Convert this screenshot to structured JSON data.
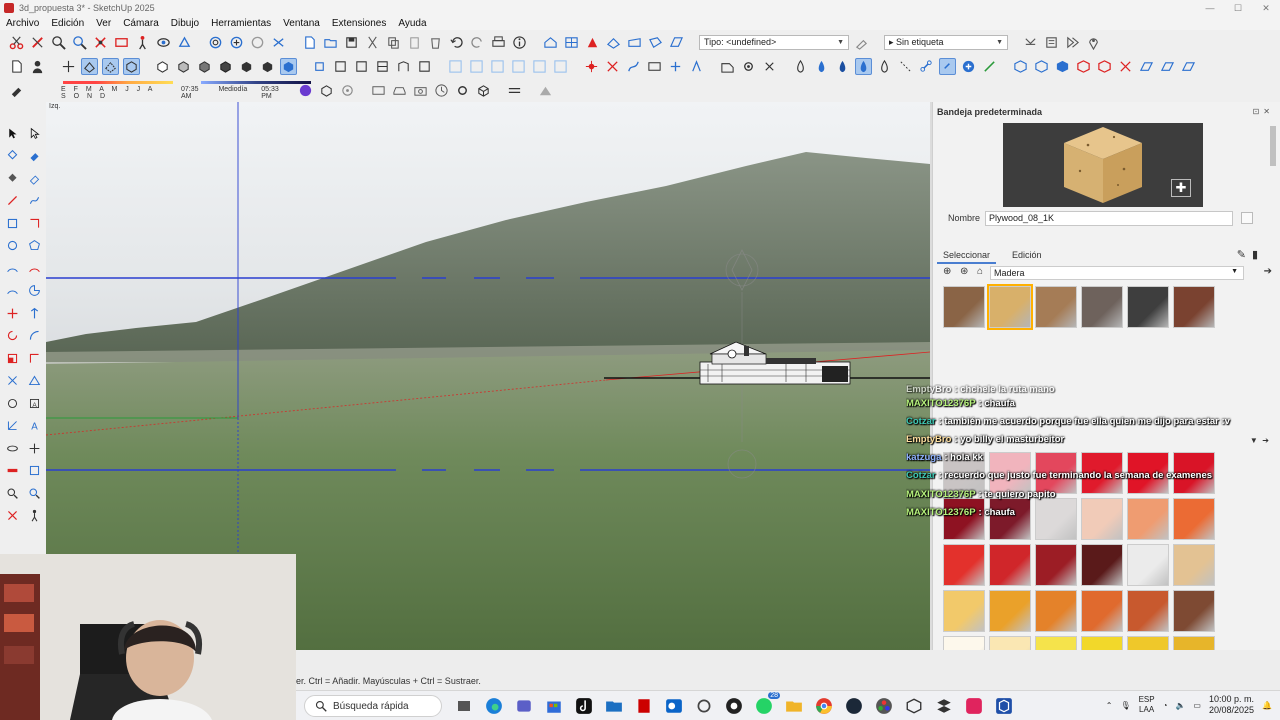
{
  "window": {
    "title": "3d_propuesta 3* - SketchUp 2025"
  },
  "menu": [
    "Archivo",
    "Edición",
    "Ver",
    "Cámara",
    "Dibujo",
    "Herramientas",
    "Ventana",
    "Extensiones",
    "Ayuda"
  ],
  "toolbar": {
    "tipo_value": "Tipo: <undefined>",
    "tag_value": "Sin etiqueta"
  },
  "shadow": {
    "months": "E F M A M J J A S O N D",
    "time_start": "07:35 AM",
    "time_mid": "Mediodía",
    "time_end": "05:33 PM"
  },
  "viewport": {
    "scene_label": "Izq."
  },
  "tray_panel": {
    "title": "Bandeja predeterminada",
    "name_label": "Nombre",
    "material_name": "Plywood_08_1K",
    "tab_select": "Seleccionar",
    "tab_edit": "Edición",
    "library": "Madera"
  },
  "colors": {
    "wood_swatches": [
      "#8a6446",
      "#d8b06a",
      "#a57c56",
      "#6e625c",
      "#3e3e3e",
      "#7a4230"
    ],
    "grid_swatches": [
      "#c9c4c4",
      "#f1b4bd",
      "#e3475d",
      "#e01a2c",
      "#e01427",
      "#d91427",
      "#8e1222",
      "#7d1a2a",
      "#dcd9d9",
      "#f1cbb8",
      "#ef9c71",
      "#eb6b34",
      "#e3312c",
      "#d0262a",
      "#9c1d25",
      "#5a1a1a",
      "#ebebeb",
      "#e3c293",
      "#f2c96a",
      "#eaa12a",
      "#e4822a",
      "#e06a2e",
      "#c8592e",
      "#7e4a33",
      "#fdf8ec",
      "#fae7b3",
      "#f5e34b",
      "#f2d82a",
      "#efc82a",
      "#e7b52a"
    ]
  },
  "chat": [
    {
      "user": "EmptyBro",
      "text": ": chchele la ruta mano",
      "color": "#ffffff",
      "faded": true
    },
    {
      "user": "MAXITO12376P",
      "text": ": chaufa",
      "color": "#b6f27c"
    },
    {
      "user": "Cotzar",
      "text": ": también me acuerdo porque fue ella quien me dijo para estar :v",
      "color": "#3ec9b5"
    },
    {
      "user": "EmptyBro",
      "text": ": yo billy el masturbeitor",
      "color": "#ffe0a0"
    },
    {
      "user": "katzuga",
      "text": ": hola kk",
      "color": "#8fb2ff"
    },
    {
      "user": "Cotzar",
      "text": ": recuerdo que justo fue terminando la semana de examenes",
      "color": "#3ec9b5"
    },
    {
      "user": "MAXITO12376P",
      "text": ": te quiero papito",
      "color": "#b6f27c"
    },
    {
      "user": "MAXITO12376P",
      "text": ": chaufa",
      "color": "#b6f27c"
    }
  ],
  "status": {
    "hint": "er. Ctrl = Añadir. Mayúsculas + Ctrl = Sustraer."
  },
  "taskbar": {
    "search_label": "Búsqueda rápida",
    "lang_1": "ESP",
    "lang_2": "LAA",
    "time": "10:00 p. m.",
    "date": "20/08/2025",
    "notif_badge": "28"
  }
}
